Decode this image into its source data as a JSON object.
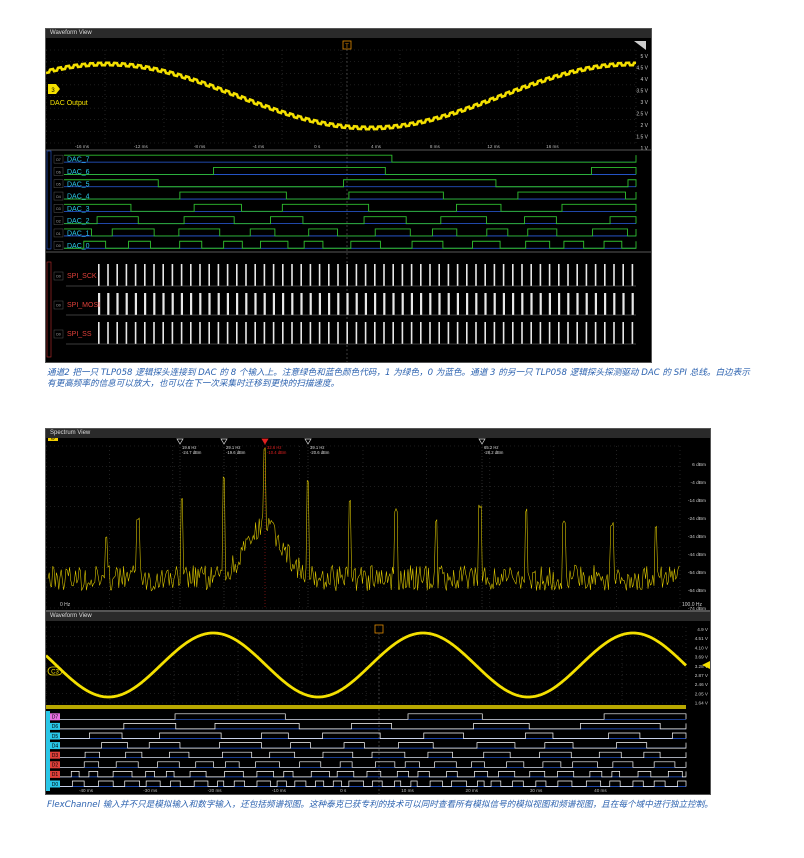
{
  "top_view": {
    "title": "Waveform View",
    "analog_label": "DAC Output",
    "channel_marker": "3",
    "trigger_marker": "T",
    "y_axis": [
      "5 V",
      "4.5 V",
      "4 V",
      "3.5 V",
      "3 V",
      "2.5 V",
      "2 V",
      "1.5 V",
      "1 V"
    ],
    "x_axis": [
      "-16 ms",
      "-12 ms",
      "-8 ms",
      "-4 ms",
      "0 s",
      "4 ms",
      "8 ms",
      "12 ms",
      "16 ms"
    ],
    "digital_channels": [
      {
        "tag": "D7",
        "label": "DAC_7"
      },
      {
        "tag": "D6",
        "label": "DAC_6"
      },
      {
        "tag": "D5",
        "label": "DAC_5"
      },
      {
        "tag": "D4",
        "label": "DAC_4"
      },
      {
        "tag": "D3",
        "label": "DAC_3"
      },
      {
        "tag": "D2",
        "label": "DAC_2"
      },
      {
        "tag": "D1",
        "label": "DAC_1"
      },
      {
        "tag": "D0",
        "label": "DAC_0"
      }
    ],
    "spi_channels": [
      {
        "tag": "D0",
        "label": "SPI_SCK"
      },
      {
        "tag": "D0",
        "label": "SPI_MOSI"
      },
      {
        "tag": "D0",
        "label": "SPI_SS"
      }
    ],
    "colors": {
      "analog": "#f4e000",
      "high": "#2fbf2f",
      "low": "#2a5fe0",
      "spi": "#e8e8e8",
      "label": "#2ac7e8",
      "spi_label": "#e0403a"
    }
  },
  "caption1": "通道2 把一只 TLP058 逻辑探头连接到 DAC 的 8 个输入上。注意绿色和蓝色颜色代码，1 为绿色，0 为蓝色。通道 3 的另一只 TLP058 逻辑探头探测驱动 DAC 的 SPI 总线。白边表示有更高频率的信息可以放大，也可以在下一次采集时迁移到更快的扫描速度。",
  "spectrum_view": {
    "title": "Spectrum View",
    "badge": "b",
    "markers": [
      {
        "freq": "19.6 Hz",
        "level": "-24.7 dBm",
        "active": false
      },
      {
        "freq": "29.1 Hz",
        "level": "-19.6 dBm",
        "active": false
      },
      {
        "freq": "32.6 Hz",
        "level": "-10.4 dBm",
        "active": true
      },
      {
        "freq": "39.1 Hz",
        "level": "-20.6 dBm",
        "active": false
      },
      {
        "freq": "65.2 Hz",
        "level": "-28.2 dBm",
        "active": false
      }
    ],
    "y_axis": [
      "6 dBm",
      "-4 dBm",
      "-14 dBm",
      "-24 dBm",
      "-34 dBm",
      "-44 dBm",
      "-54 dBm",
      "-64 dBm",
      "-74 dBm"
    ],
    "x_start": "0 Hz",
    "x_end": "100.0 Hz"
  },
  "bottom_view": {
    "title": "Waveform View",
    "channel_marker": "C3",
    "y_axis": [
      "4.9 V",
      "4.51 V",
      "4.10 V",
      "3.69 V",
      "3.28 V",
      "2.87 V",
      "2.46 V",
      "2.05 V",
      "1.64 V"
    ],
    "x_axis": [
      "-40 ms",
      "-30 ms",
      "-20 ms",
      "-10 ms",
      "0 s",
      "10 ms",
      "20 ms",
      "30 ms",
      "40 ms"
    ],
    "digital_tags": [
      "D7",
      "D6",
      "D5",
      "D4",
      "D3",
      "D2",
      "D1",
      "D0"
    ]
  },
  "caption2": "FlexChannel 输入并不只是模拟输入和数字输入，还包括频谱视图。这种泰克已获专利的技术可以同时查看所有模拟信号的模拟视图和频谱视图，且在每个域中进行独立控制。"
}
